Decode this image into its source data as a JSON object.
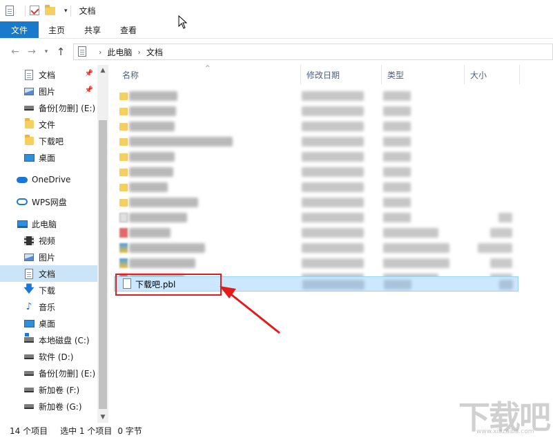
{
  "titlebar": {
    "title": "文档"
  },
  "ribbon": {
    "tabs": [
      "文件",
      "主页",
      "共享",
      "查看"
    ]
  },
  "address": {
    "crumbs": [
      "此电脑",
      "文档"
    ]
  },
  "sidebar": {
    "items": [
      {
        "label": "文档",
        "icon": "document-icon",
        "pinned": true
      },
      {
        "label": "图片",
        "icon": "picture-icon",
        "pinned": true
      },
      {
        "label": "备份[勿删] (E:)",
        "icon": "drive-icon"
      },
      {
        "label": "文件",
        "icon": "folder-icon"
      },
      {
        "label": "下载吧",
        "icon": "folder-icon"
      },
      {
        "label": "桌面",
        "icon": "desktop-icon"
      },
      {
        "label": "OneDrive",
        "icon": "onedrive-icon"
      },
      {
        "label": "WPS网盘",
        "icon": "wps-cloud-icon"
      },
      {
        "label": "此电脑",
        "icon": "this-pc-icon"
      },
      {
        "label": "视频",
        "icon": "video-icon"
      },
      {
        "label": "图片",
        "icon": "picture-icon"
      },
      {
        "label": "文档",
        "icon": "document-icon",
        "selected": true
      },
      {
        "label": "下载",
        "icon": "download-icon"
      },
      {
        "label": "音乐",
        "icon": "music-icon"
      },
      {
        "label": "桌面",
        "icon": "desktop-icon"
      },
      {
        "label": "本地磁盘 (C:)",
        "icon": "system-drive-icon"
      },
      {
        "label": "软件 (D:)",
        "icon": "drive-icon"
      },
      {
        "label": "备份[勿删] (E:)",
        "icon": "drive-icon"
      },
      {
        "label": "新加卷 (F:)",
        "icon": "drive-icon"
      },
      {
        "label": "新加卷 (G:)",
        "icon": "drive-icon"
      }
    ]
  },
  "columns": [
    "名称",
    "修改日期",
    "类型",
    "大小"
  ],
  "files": {
    "selected_name": "下载吧.pbl"
  },
  "status": {
    "count": "14 个项目",
    "selection": "选中 1 个项目",
    "size": "0 字节"
  },
  "watermark": {
    "text": "下载吧",
    "sub": "www.xiazaiba.com"
  }
}
